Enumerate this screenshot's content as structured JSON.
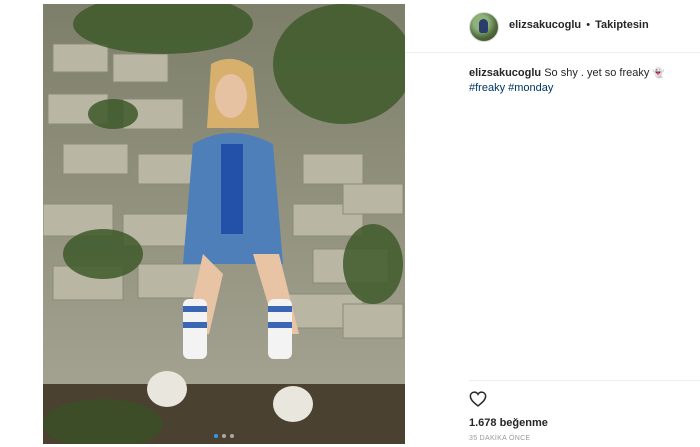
{
  "post": {
    "username": "elizsakucoglu",
    "separator": "•",
    "follow_status": "Takiptesin",
    "caption_user": "elizsakucoglu",
    "caption_text": "So shy . yet so freaky",
    "caption_emoji": "👻",
    "hashtags": [
      "#freaky",
      "#monday"
    ],
    "likes": "1.678 beğenme",
    "timestamp": "35 DAKİKA ÖNCE",
    "carousel": {
      "count": 3,
      "active_index": 0
    }
  },
  "icons": {
    "like": "heart-icon",
    "avatar": "profile-avatar"
  },
  "colors": {
    "hashtag": "#003569",
    "active_dot": "#3897f0",
    "muted": "#999999"
  }
}
